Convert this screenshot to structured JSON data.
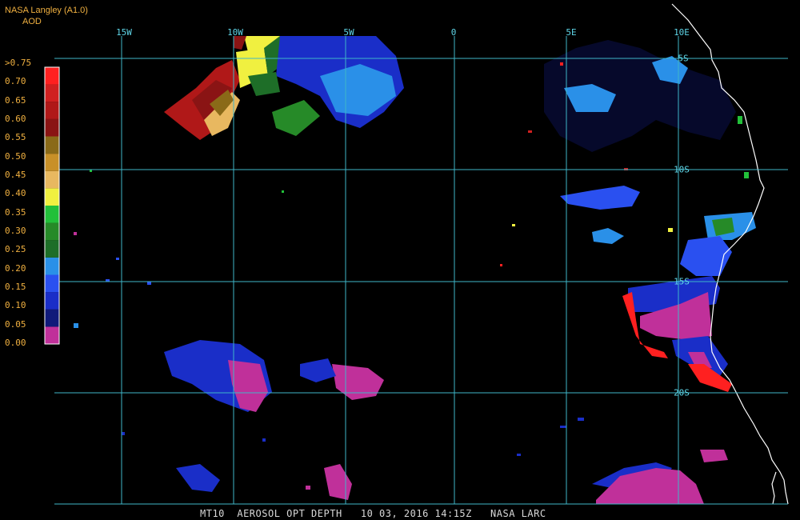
{
  "header": {
    "provider": "NASA Langley (A1.0)",
    "units": "AOD"
  },
  "colors": {
    "grid": "#3fb6c8",
    "label": "#5fd6e8",
    "legend_text": "#f0b040",
    "coast": "#ffffff",
    "background": "#000000"
  },
  "legend": {
    "ticks": [
      ">0.75",
      "0.70",
      "0.65",
      "0.60",
      "0.55",
      "0.50",
      "0.45",
      "0.40",
      "0.35",
      "0.30",
      "0.25",
      "0.20",
      "0.15",
      "0.10",
      "0.05",
      "0.00"
    ],
    "bins": [
      {
        "label": "0.00",
        "color": "#c0309a"
      },
      {
        "label": "0.05",
        "color": "#101a7a"
      },
      {
        "label": "0.10",
        "color": "#1a2ec8"
      },
      {
        "label": "0.15",
        "color": "#2a50f0"
      },
      {
        "label": "0.20",
        "color": "#2a90e8"
      },
      {
        "label": "0.25",
        "color": "#1e6e28"
      },
      {
        "label": "0.30",
        "color": "#268a28"
      },
      {
        "label": "0.35",
        "color": "#22c03a"
      },
      {
        "label": "0.40",
        "color": "#f0f040"
      },
      {
        "label": "0.45",
        "color": "#e8b860"
      },
      {
        "label": "0.50",
        "color": "#c89028"
      },
      {
        "label": "0.55",
        "color": "#8a6a18"
      },
      {
        "label": "0.60",
        "color": "#8a1414"
      },
      {
        "label": "0.65",
        "color": "#b01818"
      },
      {
        "label": "0.70",
        "color": "#d02020"
      },
      {
        "label": ">0.75",
        "color": "#ff2020"
      }
    ]
  },
  "grid": {
    "lon_labels": [
      "15W",
      "10W",
      "5W",
      "0",
      "5E",
      "10E"
    ],
    "lat_labels": [
      "5S",
      "10S",
      "15S",
      "20S"
    ]
  },
  "footer": {
    "caption": "MT10  AEROSOL OPT DEPTH   10 03, 2016 14:15Z   NASA LARC"
  }
}
